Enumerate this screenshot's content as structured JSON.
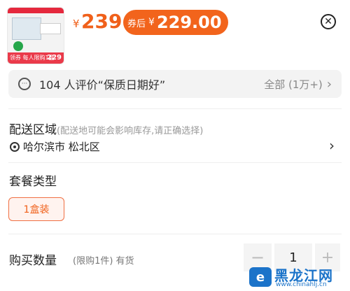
{
  "product": {
    "thumbnail_band_text": "领券 每人限购1盒",
    "thumbnail_band_price": "229",
    "price_currency": "¥",
    "price": "239",
    "coupon_label": "券后",
    "coupon_currency": "¥",
    "coupon_price": "229.00"
  },
  "close_icon": "close-icon",
  "review": {
    "text": "104 人评价“保质日期好”",
    "right_label": "全部 (1万+)",
    "chevron": "›"
  },
  "delivery": {
    "title": "配送区域",
    "hint": "(配送地可能会影响库存,请正确选择)",
    "location": "哈尔滨市 松北区",
    "chevron": "›"
  },
  "package": {
    "title": "套餐类型",
    "option": "1盒装"
  },
  "quantity": {
    "title": "购买数量",
    "hint": "(限购1件) 有货",
    "minus": "−",
    "value": "1",
    "plus": "+"
  },
  "watermark": {
    "name": "黑龙江网",
    "url": "www.chinahlj.cn"
  },
  "colors": {
    "accent": "#f0601a",
    "coupon_bg": "#f2641c",
    "review_bg": "#f3f3f3",
    "watermark": "#1b73c9"
  }
}
